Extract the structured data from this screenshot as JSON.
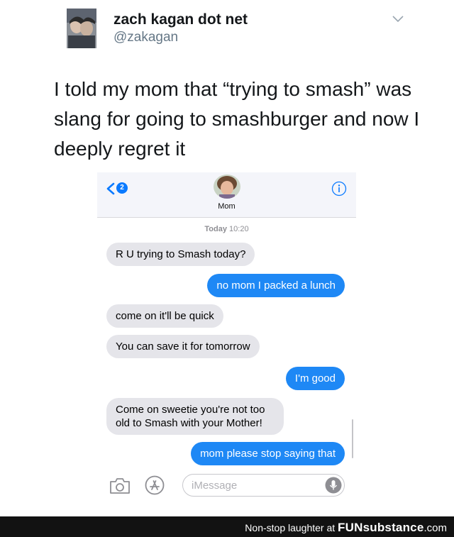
{
  "tweet": {
    "author_name": "zach kagan dot net",
    "author_handle": "@zakagan",
    "text": "I told my mom that “trying to smash” was slang for going to smashburger and now I deeply regret it"
  },
  "phone": {
    "back_badge": "2",
    "contact_name": "Mom",
    "timestamp_day": "Today",
    "timestamp_time": "10:20",
    "messages": [
      {
        "from": "them",
        "text": "R U trying to Smash today?"
      },
      {
        "from": "me",
        "text": "no mom I packed a lunch"
      },
      {
        "from": "them",
        "text": "come on it'll be quick"
      },
      {
        "from": "them",
        "text": "You can save it for tomorrow"
      },
      {
        "from": "me",
        "text": "I'm good"
      },
      {
        "from": "them",
        "text": "Come on sweetie you're not too old to Smash with your Mother!"
      },
      {
        "from": "me",
        "text": "mom please stop saying that"
      }
    ],
    "compose_placeholder": "iMessage",
    "colors": {
      "outgoing": "#1e88f5",
      "incoming": "#e5e5ea",
      "accent": "#0a7aff"
    }
  },
  "footer": {
    "text": "Non-stop laughter at",
    "brand": "FUNsubstance",
    "tld": ".com"
  }
}
